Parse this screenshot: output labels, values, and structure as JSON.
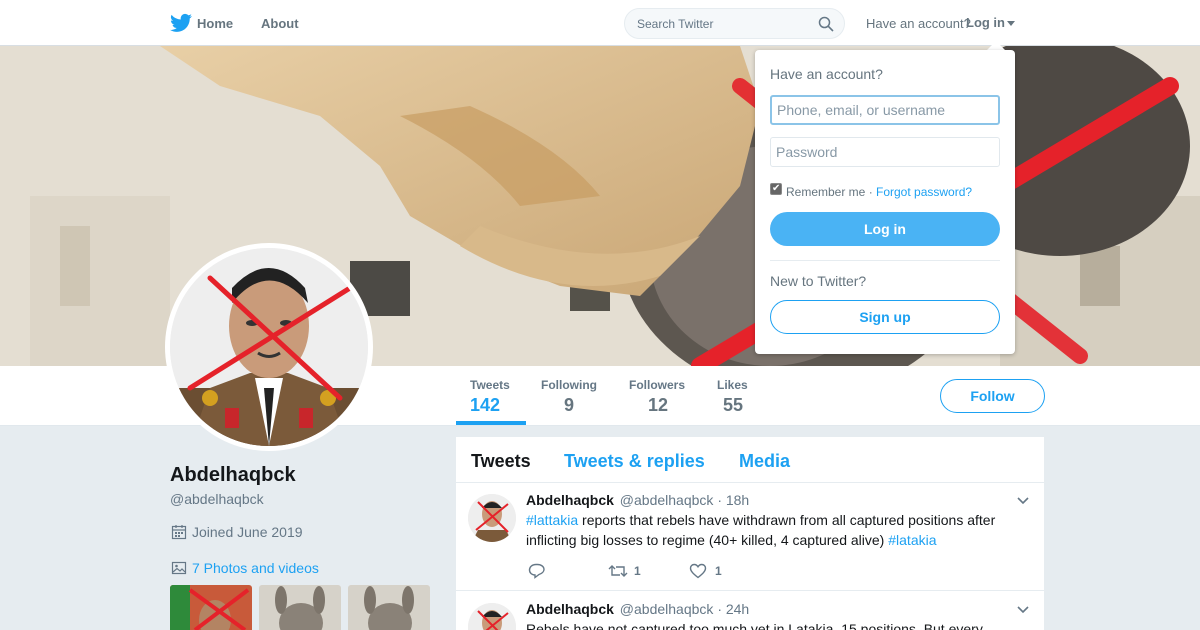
{
  "nav": {
    "home_label": "Home",
    "about_label": "About",
    "search_placeholder": "Search Twitter",
    "have_account": "Have an account?",
    "login_label": "Log in"
  },
  "profile": {
    "name": "Abdelhaqbck",
    "handle": "@abdelhaqbck",
    "joined": "Joined June 2019",
    "photos": "7 Photos and videos",
    "follow_label": "Follow"
  },
  "stats": [
    {
      "label": "Tweets",
      "value": "142"
    },
    {
      "label": "Following",
      "value": "9"
    },
    {
      "label": "Followers",
      "value": "12"
    },
    {
      "label": "Likes",
      "value": "55"
    }
  ],
  "timeline": {
    "tabs": [
      "Tweets",
      "Tweets & replies",
      "Media"
    ],
    "tweets": [
      {
        "name": "Abdelhaqbck",
        "handle": "@abdelhaqbck",
        "time": "· 18h",
        "hashtag1": "#lattakia",
        "text": " reports that rebels have withdrawn from all captured positions after inflicting big losses to regime (40+ killed, 4 captured alive) ",
        "hashtag2": "#latakia",
        "retweets": "1",
        "likes": "1"
      },
      {
        "name": "Abdelhaqbck",
        "handle": "@abdelhaqbck",
        "time": "· 24h",
        "text": "Rebels have not captured too much yet in Latakia. 15 positions. But every"
      }
    ]
  },
  "login_dropdown": {
    "title": "Have an account?",
    "username_placeholder": "Phone, email, or username",
    "password_placeholder": "Password",
    "remember_me": "Remember me ·",
    "forgot_password": "Forgot password?",
    "login_button": "Log in",
    "new_to_twitter": "New to Twitter?",
    "signup_button": "Sign up"
  },
  "colors": {
    "accent": "#1da1f2",
    "login_button": "#4ab3f4",
    "background": "#e6ecf0"
  },
  "icons": [
    "twitter-bird-icon",
    "search-icon",
    "caret-down-icon",
    "calendar-icon",
    "photo-icon",
    "reply-icon",
    "retweet-icon",
    "heart-icon",
    "chevron-down-icon"
  ]
}
